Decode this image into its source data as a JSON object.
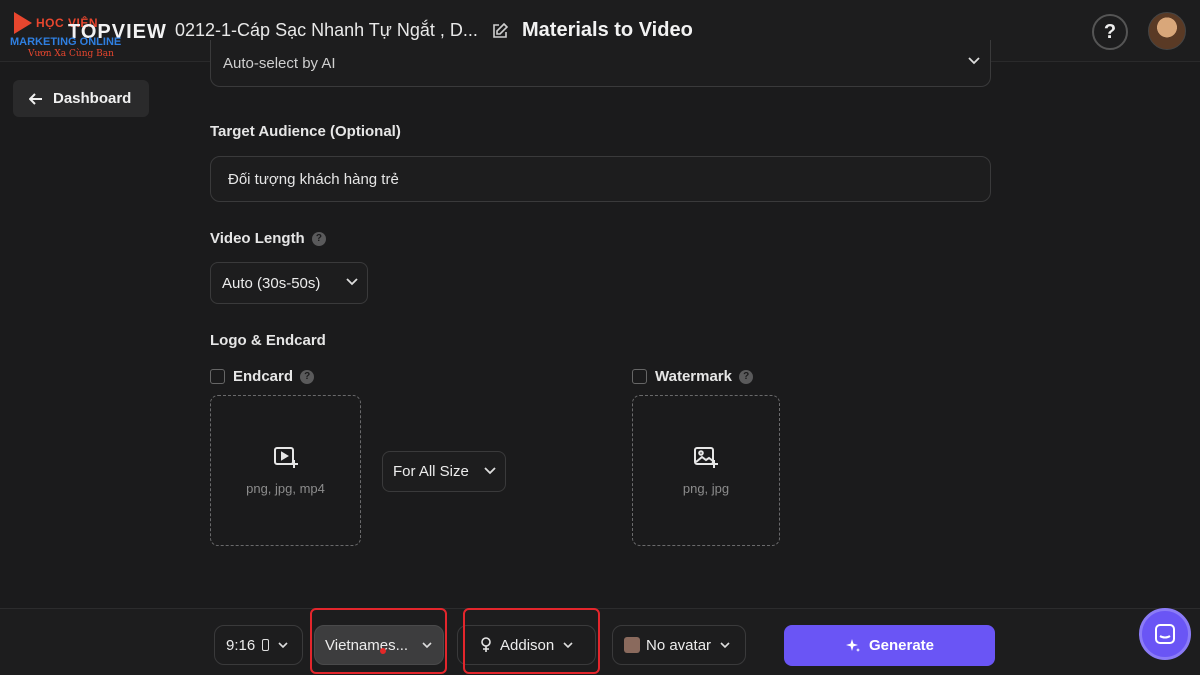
{
  "brand": {
    "overlay_name": "HỌC VIỆN",
    "overlay_sub": "MARKETING ONLINE",
    "overlay_slogan": "Vươn Xa Cùng Bạn",
    "app_name": "TOPVIEW"
  },
  "header": {
    "project_title": "0212-1-Cáp Sạc Nhanh Tự Ngắt , D...",
    "page_title": "Materials to Video",
    "help_label": "?"
  },
  "nav": {
    "dashboard_label": "Dashboard"
  },
  "form": {
    "top_select_value": "Auto-select by AI",
    "audience_label": "Target Audience (Optional)",
    "audience_value": "Đối tượng khách hàng trẻ",
    "length_label": "Video Length",
    "length_value": "Auto (30s-50s)",
    "logo_section_label": "Logo & Endcard",
    "endcard_label": "Endcard",
    "endcard_hint": "png, jpg, mp4",
    "size_value": "For All Size",
    "watermark_label": "Watermark",
    "watermark_hint": "png, jpg"
  },
  "bottom": {
    "ratio_value": "9:16",
    "language_value": "Vietnames...",
    "voice_value": "Addison",
    "avatar_value": "No avatar",
    "generate_label": "Generate"
  },
  "colors": {
    "background": "#1b1b1c",
    "accent": "#6a55f5",
    "highlight": "#e3262c"
  },
  "icons": [
    "back-arrow-icon",
    "edit-icon",
    "chevron-down-icon",
    "help-icon",
    "video-upload-icon",
    "image-upload-icon",
    "portrait-icon",
    "female-voice-icon",
    "sparkle-icon",
    "chat-icon"
  ]
}
